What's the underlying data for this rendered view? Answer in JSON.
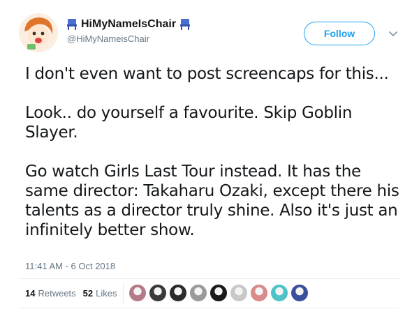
{
  "user": {
    "display_name": "HiMyNameIsChair",
    "handle": "@HiMyNameisChair",
    "name_icon": "chair-icon"
  },
  "actions": {
    "follow_label": "Follow",
    "menu_icon": "chevron-down-icon"
  },
  "tweet": {
    "paragraphs": [
      "I don't even want to post screencaps for this...",
      "Look.. do yourself a favourite.  Skip Goblin Slayer.",
      "Go watch Girls Last Tour instead. It has the same director: Takaharu Ozaki, except there his talents as a director truly shine. Also it's just an infinitely better show."
    ],
    "timestamp": "11:41 AM - 6 Oct 2018"
  },
  "stats": {
    "retweets_count": "14",
    "retweets_label": "Retweets",
    "likes_count": "52",
    "likes_label": "Likes"
  },
  "liker_avatars": [
    {
      "name": "liker-avatar-1",
      "color": "#b47a86"
    },
    {
      "name": "liker-avatar-2",
      "color": "#3a3a3a"
    },
    {
      "name": "liker-avatar-3",
      "color": "#2b2b2b"
    },
    {
      "name": "liker-avatar-4",
      "color": "#9a9a9a"
    },
    {
      "name": "liker-avatar-5",
      "color": "#1a1a1a"
    },
    {
      "name": "liker-avatar-6",
      "color": "#c8c8c8"
    },
    {
      "name": "liker-avatar-7",
      "color": "#d98a8a"
    },
    {
      "name": "liker-avatar-8",
      "color": "#4fc3c7"
    },
    {
      "name": "liker-avatar-9",
      "color": "#3b4fa0"
    }
  ],
  "colors": {
    "accent": "#1da1f2",
    "text": "#14171a",
    "muted": "#657786",
    "divider": "#e6ecf0"
  }
}
